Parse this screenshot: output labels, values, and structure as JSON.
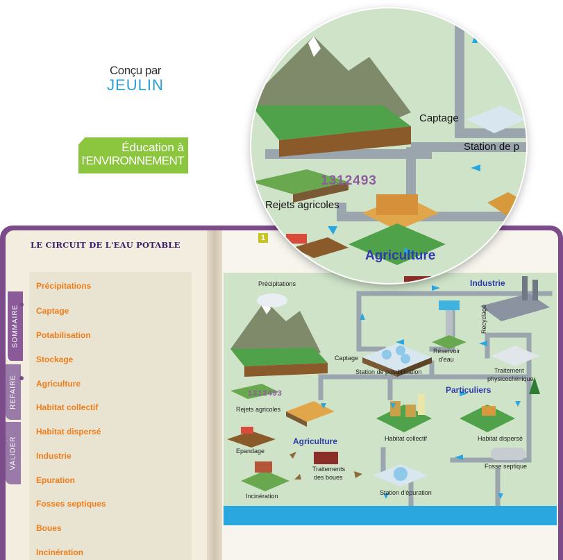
{
  "branding": {
    "concu_par": "Conçu par",
    "jeulin": "JEULIN",
    "education_line1": "Éducation à",
    "education_line2": "l'ENVIRONNEMENT"
  },
  "sidebar": {
    "title": "LE CIRCUIT DE L'EAU POTABLE",
    "items": [
      {
        "label": "Précipitations"
      },
      {
        "label": "Captage"
      },
      {
        "label": "Potabilisation"
      },
      {
        "label": "Stockage"
      },
      {
        "label": "Agriculture"
      },
      {
        "label": "Habitat collectif"
      },
      {
        "label": "Habitat dispersé"
      },
      {
        "label": "Industrie"
      },
      {
        "label": "Epuration"
      },
      {
        "label": "Fosses septiques"
      },
      {
        "label": "Boues"
      },
      {
        "label": "Incinération"
      }
    ]
  },
  "tabs": {
    "sommaire": "SOMMAIRE",
    "refaire": "REFAIRE",
    "valider": "VALIDER"
  },
  "page": {
    "number_badge": "1"
  },
  "diagram": {
    "labels": {
      "precipitations": "Précipitations",
      "industrie": "Industrie",
      "recyclage": "Recyclage",
      "traitement": "Traitement",
      "physicochimique": "physicochimique",
      "reservoir": "Réservoir",
      "d_eau": "d'eau",
      "captage": "Captage",
      "station_potabilisation": "Station de potabilisation",
      "particuliers": "Particuliers",
      "code": "1312493",
      "rejets_agricoles": "Rejets agricoles",
      "agriculture": "Agriculture",
      "habitat_collectif": "Habitat collectif",
      "habitat_disperse": "Habitat dispersé",
      "epandage": "Epandage",
      "fosse_septique": "Fosse septique",
      "traitements": "Traitements",
      "des_boues": "des boues",
      "incineration": "Incinération",
      "station_epuration": "Station d'épuration"
    }
  },
  "magnifier": {
    "captage": "Captage",
    "station": "Station de p",
    "code": "1312493",
    "rejets_agricoles": "Rejets agricoles",
    "agriculture": "Agriculture"
  },
  "colors": {
    "purple_frame": "#7b4b8a",
    "orange_menu": "#f07d1a",
    "heading_navy": "#3a1d6e",
    "jeulin_blue": "#2a9fd8",
    "edu_green": "#8cc63f",
    "diagram_bg": "#cfe3c9",
    "pipe": "#9aa5ae",
    "river": "#2ba7df",
    "label_blue": "#2d3ca8"
  }
}
